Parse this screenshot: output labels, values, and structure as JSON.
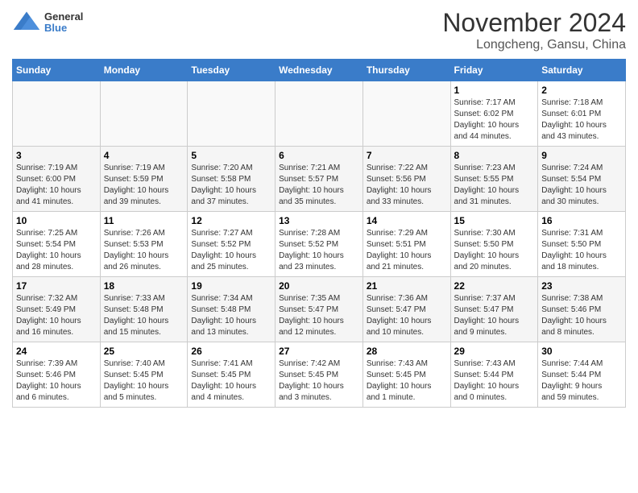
{
  "header": {
    "logo_general": "General",
    "logo_blue": "Blue",
    "month_title": "November 2024",
    "location": "Longcheng, Gansu, China"
  },
  "weekdays": [
    "Sunday",
    "Monday",
    "Tuesday",
    "Wednesday",
    "Thursday",
    "Friday",
    "Saturday"
  ],
  "weeks": [
    [
      {
        "day": "",
        "info": ""
      },
      {
        "day": "",
        "info": ""
      },
      {
        "day": "",
        "info": ""
      },
      {
        "day": "",
        "info": ""
      },
      {
        "day": "",
        "info": ""
      },
      {
        "day": "1",
        "info": "Sunrise: 7:17 AM\nSunset: 6:02 PM\nDaylight: 10 hours\nand 44 minutes."
      },
      {
        "day": "2",
        "info": "Sunrise: 7:18 AM\nSunset: 6:01 PM\nDaylight: 10 hours\nand 43 minutes."
      }
    ],
    [
      {
        "day": "3",
        "info": "Sunrise: 7:19 AM\nSunset: 6:00 PM\nDaylight: 10 hours\nand 41 minutes."
      },
      {
        "day": "4",
        "info": "Sunrise: 7:19 AM\nSunset: 5:59 PM\nDaylight: 10 hours\nand 39 minutes."
      },
      {
        "day": "5",
        "info": "Sunrise: 7:20 AM\nSunset: 5:58 PM\nDaylight: 10 hours\nand 37 minutes."
      },
      {
        "day": "6",
        "info": "Sunrise: 7:21 AM\nSunset: 5:57 PM\nDaylight: 10 hours\nand 35 minutes."
      },
      {
        "day": "7",
        "info": "Sunrise: 7:22 AM\nSunset: 5:56 PM\nDaylight: 10 hours\nand 33 minutes."
      },
      {
        "day": "8",
        "info": "Sunrise: 7:23 AM\nSunset: 5:55 PM\nDaylight: 10 hours\nand 31 minutes."
      },
      {
        "day": "9",
        "info": "Sunrise: 7:24 AM\nSunset: 5:54 PM\nDaylight: 10 hours\nand 30 minutes."
      }
    ],
    [
      {
        "day": "10",
        "info": "Sunrise: 7:25 AM\nSunset: 5:54 PM\nDaylight: 10 hours\nand 28 minutes."
      },
      {
        "day": "11",
        "info": "Sunrise: 7:26 AM\nSunset: 5:53 PM\nDaylight: 10 hours\nand 26 minutes."
      },
      {
        "day": "12",
        "info": "Sunrise: 7:27 AM\nSunset: 5:52 PM\nDaylight: 10 hours\nand 25 minutes."
      },
      {
        "day": "13",
        "info": "Sunrise: 7:28 AM\nSunset: 5:52 PM\nDaylight: 10 hours\nand 23 minutes."
      },
      {
        "day": "14",
        "info": "Sunrise: 7:29 AM\nSunset: 5:51 PM\nDaylight: 10 hours\nand 21 minutes."
      },
      {
        "day": "15",
        "info": "Sunrise: 7:30 AM\nSunset: 5:50 PM\nDaylight: 10 hours\nand 20 minutes."
      },
      {
        "day": "16",
        "info": "Sunrise: 7:31 AM\nSunset: 5:50 PM\nDaylight: 10 hours\nand 18 minutes."
      }
    ],
    [
      {
        "day": "17",
        "info": "Sunrise: 7:32 AM\nSunset: 5:49 PM\nDaylight: 10 hours\nand 16 minutes."
      },
      {
        "day": "18",
        "info": "Sunrise: 7:33 AM\nSunset: 5:48 PM\nDaylight: 10 hours\nand 15 minutes."
      },
      {
        "day": "19",
        "info": "Sunrise: 7:34 AM\nSunset: 5:48 PM\nDaylight: 10 hours\nand 13 minutes."
      },
      {
        "day": "20",
        "info": "Sunrise: 7:35 AM\nSunset: 5:47 PM\nDaylight: 10 hours\nand 12 minutes."
      },
      {
        "day": "21",
        "info": "Sunrise: 7:36 AM\nSunset: 5:47 PM\nDaylight: 10 hours\nand 10 minutes."
      },
      {
        "day": "22",
        "info": "Sunrise: 7:37 AM\nSunset: 5:47 PM\nDaylight: 10 hours\nand 9 minutes."
      },
      {
        "day": "23",
        "info": "Sunrise: 7:38 AM\nSunset: 5:46 PM\nDaylight: 10 hours\nand 8 minutes."
      }
    ],
    [
      {
        "day": "24",
        "info": "Sunrise: 7:39 AM\nSunset: 5:46 PM\nDaylight: 10 hours\nand 6 minutes."
      },
      {
        "day": "25",
        "info": "Sunrise: 7:40 AM\nSunset: 5:45 PM\nDaylight: 10 hours\nand 5 minutes."
      },
      {
        "day": "26",
        "info": "Sunrise: 7:41 AM\nSunset: 5:45 PM\nDaylight: 10 hours\nand 4 minutes."
      },
      {
        "day": "27",
        "info": "Sunrise: 7:42 AM\nSunset: 5:45 PM\nDaylight: 10 hours\nand 3 minutes."
      },
      {
        "day": "28",
        "info": "Sunrise: 7:43 AM\nSunset: 5:45 PM\nDaylight: 10 hours\nand 1 minute."
      },
      {
        "day": "29",
        "info": "Sunrise: 7:43 AM\nSunset: 5:44 PM\nDaylight: 10 hours\nand 0 minutes."
      },
      {
        "day": "30",
        "info": "Sunrise: 7:44 AM\nSunset: 5:44 PM\nDaylight: 9 hours\nand 59 minutes."
      }
    ]
  ]
}
